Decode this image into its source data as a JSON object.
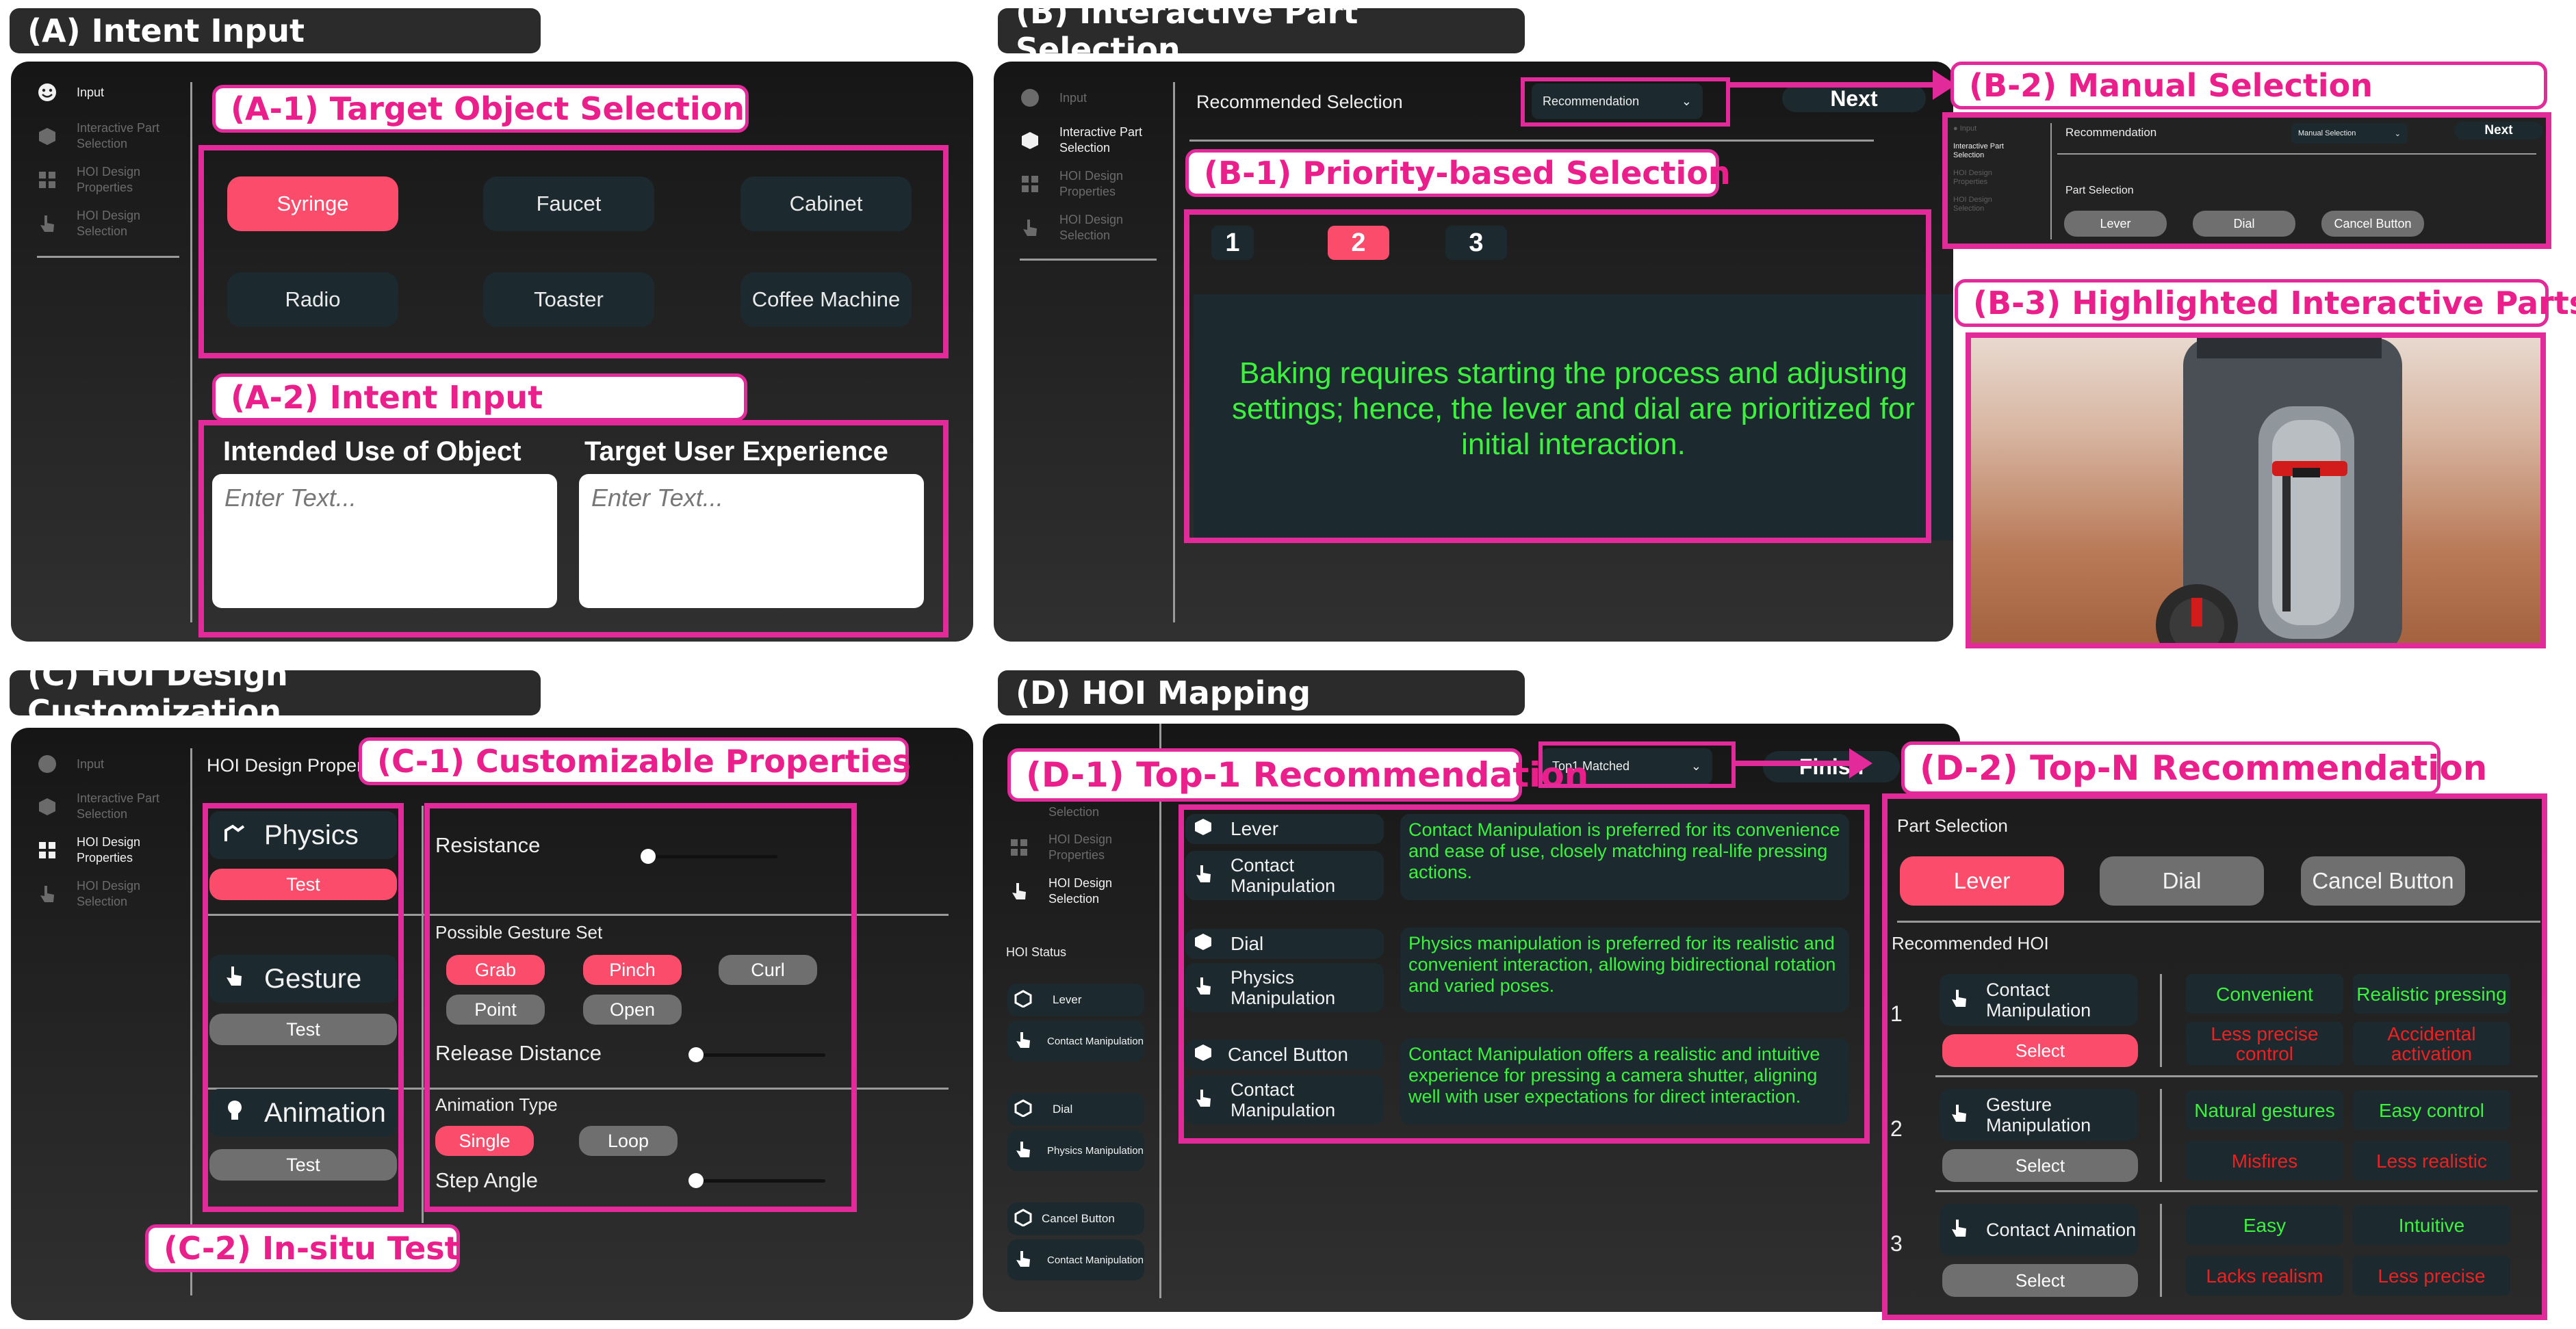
{
  "titles": {
    "a": "(A) Intent Input",
    "b": "(B) Interactive Part Selection",
    "c": "(C) HOI Design Customization",
    "d": "(D) HOI Mapping"
  },
  "nav": {
    "input": "Input",
    "interactive": "Interactive Part Selection",
    "design": "HOI Design Properties",
    "hoi": "HOI Design Selection"
  },
  "a": {
    "label_a1": "(A-1) Target Object Selection",
    "objects": [
      "Syringe",
      "Faucet",
      "Cabinet",
      "Radio",
      "Toaster",
      "Coffee Machine"
    ],
    "selected": "Syringe",
    "label_a2": "(A-2) Intent Input",
    "field1_label": "Intended Use of Object",
    "field2_label": "Target User Experience",
    "placeholder": "Enter Text..."
  },
  "b": {
    "header": "Recommended Selection",
    "dropdown": "Recommendation",
    "next": "Next",
    "label_b1": "(B-1) Priority-based Selection",
    "tabs": [
      "1",
      "2",
      "3"
    ],
    "active_tab": "2",
    "reason": "Baking requires starting the process and adjusting settings; hence, the lever and dial are prioritized for initial interaction.",
    "label_b2": "(B-2) Manual Selection",
    "b2": {
      "header": "Recommendation",
      "dropdown": "Manual Selection",
      "next": "Next",
      "part_label": "Part Selection",
      "parts": [
        "Lever",
        "Dial",
        "Cancel Button"
      ]
    },
    "label_b3": "(B-3) Highlighted Interactive Parts"
  },
  "c": {
    "header": "HOI Design Properties",
    "label_c1": "(C-1) Customizable Properties",
    "categories": [
      {
        "name": "Physics",
        "test": "Test"
      },
      {
        "name": "Gesture",
        "test": "Test"
      },
      {
        "name": "Animation",
        "test": "Test"
      }
    ],
    "resistance": "Resistance",
    "gesture_set_label": "Possible Gesture Set",
    "gestures": [
      "Grab",
      "Pinch",
      "Curl",
      "Point",
      "Open"
    ],
    "release": "Release Distance",
    "anim_type_label": "Animation Type",
    "anim_types": [
      "Single",
      "Loop"
    ],
    "step": "Step Angle",
    "label_c2": "(C-2) In-situ Test"
  },
  "d": {
    "dropdown": "Top1 Matched",
    "finish": "Finish",
    "label_d1": "(D-1) Top-1 Recommendation",
    "nav_selection": "Selection",
    "hoi_status": "HOI Status",
    "status": [
      {
        "part": "Lever",
        "method": "Contact Manipulation"
      },
      {
        "part": "Dial",
        "method": "Physics Manipulation"
      },
      {
        "part": "Cancel Button",
        "method": "Contact Manipulation"
      }
    ],
    "recs": [
      {
        "part": "Lever",
        "method": "Contact Manipulation",
        "text": "Contact Manipulation is preferred for its convenience and ease of use, closely matching real-life pressing actions."
      },
      {
        "part": "Dial",
        "method": "Physics Manipulation",
        "text": "Physics manipulation is preferred for its realistic and convenient interaction, allowing bidirectional rotation and varied poses."
      },
      {
        "part": "Cancel Button",
        "method": "Contact Manipulation",
        "text": "Contact Manipulation offers a realistic and intuitive experience for pressing a camera shutter, aligning well with user expectations for direct interaction."
      }
    ],
    "label_d2": "(D-2) Top-N Recommendation",
    "part_label": "Part Selection",
    "parts": [
      "Lever",
      "Dial",
      "Cancel Button"
    ],
    "rec_label": "Recommended HOI",
    "topn": [
      {
        "rank": "1",
        "method": "Contact Manipulation",
        "select": "Select",
        "pros": [
          "Convenient",
          "Realistic pressing"
        ],
        "cons": [
          "Less precise control",
          "Accidental activation"
        ]
      },
      {
        "rank": "2",
        "method": "Gesture Manipulation",
        "select": "Select",
        "pros": [
          "Natural gestures",
          "Easy control"
        ],
        "cons": [
          "Misfires",
          "Less realistic"
        ]
      },
      {
        "rank": "3",
        "method": "Contact Animation",
        "select": "Select",
        "pros": [
          "Easy",
          "Intuitive"
        ],
        "cons": [
          "Lacks realism",
          "Less precise"
        ]
      }
    ]
  },
  "colors": {
    "accent": "#e22a9b",
    "pink_button": "#fb4c6c",
    "dark_button": "#1c2a30",
    "green_text": "#3df23d",
    "red_text": "#ee2020"
  }
}
